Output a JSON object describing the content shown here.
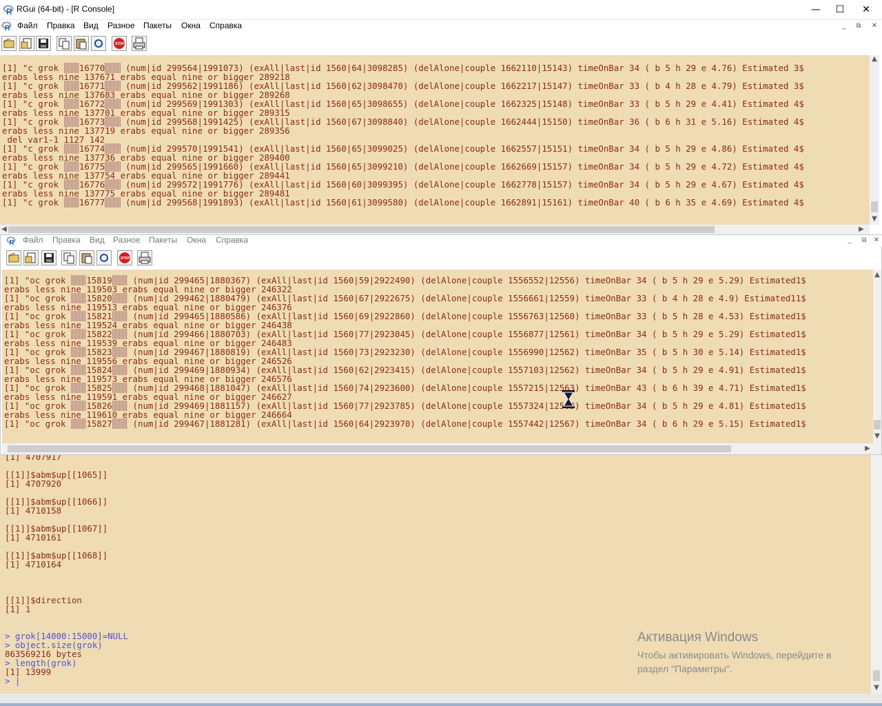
{
  "window": {
    "title": "RGui (64-bit) - [R Console]"
  },
  "menu": [
    "Файл",
    "Правка",
    "Вид",
    "Разное",
    "Пакеты",
    "Окна",
    "Справка"
  ],
  "toolbar_icons": [
    "open-script-icon",
    "load-workspace-icon",
    "save-icon",
    "copy-icon",
    "paste-icon",
    "copy-paste-icon",
    "stop-icon",
    "print-icon"
  ],
  "colors": {
    "console_bg": "#efdcb4",
    "output_text": "#8b2a1a",
    "input_text": "#5050e0"
  },
  "console_top": {
    "lines": [
      [
        "[1] \"c grok ",
        "▒▒▒",
        "16770",
        "▒▒▒",
        " (num|id 299564|1991073) (exAll|last|id 1560|64|3098285) (delAlone|couple 1662110|15143) timeOnBar 34 ( b 5 h 29 e 4.76) Estimated 3$"
      ],
      [
        "erabs less nine 137671 erabs equal nine or bigger 289218"
      ],
      [
        "[1] \"c grok ",
        "▒▒▒",
        "16771",
        "▒▒▒",
        " (num|id 299562|1991186) (exAll|last|id 1560|62|3098470) (delAlone|couple 1662217|15147) timeOnBar 33 ( b 4 h 28 e 4.79) Estimated 3$"
      ],
      [
        "erabs less nine 137683 erabs equal nine or bigger 289268"
      ],
      [
        "[1] \"c grok ",
        "▒▒▒",
        "16772",
        "▒▒▒",
        " (num|id 299569|1991303) (exAll|last|id 1560|65|3098655) (delAlone|couple 1662325|15148) timeOnBar 33 ( b 5 h 29 e 4.41) Estimated 4$"
      ],
      [
        "erabs less nine 137701 erabs equal nine or bigger 289315"
      ],
      [
        "[1] \"c grok ",
        "▒▒▒",
        "16773",
        "▒▒▒",
        " (num|id 299568|1991425) (exAll|last|id 1560|67|3098840) (delAlone|couple 1662444|15150) timeOnBar 36 ( b 6 h 31 e 5.16) Estimated 4$"
      ],
      [
        "erabs less nine 137719 erabs equal nine or bigger 289356"
      ],
      [
        " del var1-1 1127 142"
      ],
      [
        "[1] \"c grok ",
        "▒▒▒",
        "16774",
        "▒▒▒",
        " (num|id 299570|1991541) (exAll|last|id 1560|65|3099025) (delAlone|couple 1662557|15151) timeOnBar 34 ( b 5 h 29 e 4.86) Estimated 4$"
      ],
      [
        "erabs less nine 137736 erabs equal nine or bigger 289400"
      ],
      [
        "[1] \"c grok ",
        "▒▒▒",
        "16775",
        "▒▒▒",
        " (num|id 299565|1991660) (exAll|last|id 1560|65|3099210) (delAlone|couple 1662669|15157) timeOnBar 34 ( b 5 h 29 e 4.72) Estimated 4$"
      ],
      [
        "erabs less nine 137754 erabs equal nine or bigger 289441"
      ],
      [
        "[1] \"c grok ",
        "▒▒▒",
        "16776",
        "▒▒▒",
        " (num|id 299572|1991776) (exAll|last|id 1560|60|3099395) (delAlone|couple 1662778|15157) timeOnBar 34 ( b 5 h 29 e 4.67) Estimated 4$"
      ],
      [
        "erabs less nine 137775 erabs equal nine or bigger 289481"
      ],
      [
        "[1] \"c grok ",
        "▒▒▒",
        "16777",
        "▒▒▒",
        " (num|id 299568|1991893) (exAll|last|id 1560|61|3099580) (delAlone|couple 1662891|15161) timeOnBar 40 ( b 6 h 35 e 4.69) Estimated 4$"
      ]
    ]
  },
  "console_middle": {
    "menu": [
      "Файл",
      "Правка",
      "Вид",
      "Разное",
      "Пакеты",
      "Окна",
      "Справка"
    ],
    "lines": [
      [
        "[1] \"oc grok ",
        "▒▒▒",
        "15819",
        "▒▒▒",
        " (num|id 299465|1880367) (exAll|last|id 1560|59|2922490) (delAlone|couple 1556552|12556) timeOnBar 34 ( b 5 h 29 e 5.29) Estimated1$"
      ],
      [
        "erabs less nine 119503 erabs equal nine or bigger 246322"
      ],
      [
        "[1] \"oc grok ",
        "▒▒▒",
        "15820",
        "▒▒▒",
        " (num|id 299462|1880479) (exAll|last|id 1560|67|2922675) (delAlone|couple 1556661|12559) timeOnBar 33 ( b 4 h 28 e 4.9) Estimated11$"
      ],
      [
        "erabs less nine 119513 erabs equal nine or bigger 246376"
      ],
      [
        "[1] \"oc grok ",
        "▒▒▒",
        "15821",
        "▒▒▒",
        " (num|id 299465|1880586) (exAll|last|id 1560|69|2922860) (delAlone|couple 1556763|12560) timeOnBar 33 ( b 5 h 28 e 4.53) Estimated1$"
      ],
      [
        "erabs less nine 119524 erabs equal nine or bigger 246438"
      ],
      [
        "[1] \"oc grok ",
        "▒▒▒",
        "15822",
        "▒▒▒",
        " (num|id 299466|1880703) (exAll|last|id 1560|77|2923045) (delAlone|couple 1556877|12561) timeOnBar 34 ( b 5 h 29 e 5.29) Estimated1$"
      ],
      [
        "erabs less nine 119539 erabs equal nine or bigger 246483"
      ],
      [
        "[1] \"oc grok ",
        "▒▒▒",
        "15823",
        "▒▒▒",
        " (num|id 299467|1880819) (exAll|last|id 1560|73|2923230) (delAlone|couple 1556990|12562) timeOnBar 35 ( b 5 h 30 e 5.14) Estimated1$"
      ],
      [
        "erabs less nine 119556 erabs equal nine or bigger 246526"
      ],
      [
        "[1] \"oc grok ",
        "▒▒▒",
        "15824",
        "▒▒▒",
        " (num|id 299469|1880934) (exAll|last|id 1560|62|2923415) (delAlone|couple 1557103|12562) timeOnBar 34 ( b 5 h 29 e 4.91) Estimated1$"
      ],
      [
        "erabs less nine 119573 erabs equal nine or bigger 246576"
      ],
      [
        "[1] \"oc grok ",
        "▒▒▒",
        "15825",
        "▒▒▒",
        " (num|id 299468|1881047) (exAll|last|id 1560|74|2923600) (delAlone|couple 1557215|12563) timeOnBar 43 ( b 6 h 39 e 4.71) Estimated1$"
      ],
      [
        "erabs less nine 119591 erabs equal nine or bigger 246627"
      ],
      [
        "[1] \"oc grok ",
        "▒▒▒",
        "15826",
        "▒▒▒",
        " (num|id 299469|1881157) (exAll|last|id 1560|77|2923785) (delAlone|couple 1557324|12563) timeOnBar 34 ( b 5 h 29 e 4.81) Estimated1$"
      ],
      [
        "erabs less nine 119610 erabs equal nine or bigger 246664"
      ],
      [
        "[1] \"oc grok ",
        "▒▒▒",
        "15827",
        "▒▒▒",
        " (num|id 299467|1881281) (exAll|last|id 1560|64|2923970) (delAlone|couple 1557442|12567) timeOnBar 34 ( b 6 h 29 e 5.15) Estimated1$"
      ]
    ]
  },
  "console_bottom": {
    "lines": [
      {
        "text": "[1] 4707917",
        "kind": "out"
      },
      {
        "text": "",
        "kind": "out"
      },
      {
        "text": "[[1]]$abm$up[[1065]]",
        "kind": "out"
      },
      {
        "text": "[1] 4707920",
        "kind": "out"
      },
      {
        "text": "",
        "kind": "out"
      },
      {
        "text": "[[1]]$abm$up[[1066]]",
        "kind": "out"
      },
      {
        "text": "[1] 4710158",
        "kind": "out"
      },
      {
        "text": "",
        "kind": "out"
      },
      {
        "text": "[[1]]$abm$up[[1067]]",
        "kind": "out"
      },
      {
        "text": "[1] 4710161",
        "kind": "out"
      },
      {
        "text": "",
        "kind": "out"
      },
      {
        "text": "[[1]]$abm$up[[1068]]",
        "kind": "out"
      },
      {
        "text": "[1] 4710164",
        "kind": "out"
      },
      {
        "text": "",
        "kind": "out"
      },
      {
        "text": "",
        "kind": "out"
      },
      {
        "text": "",
        "kind": "out"
      },
      {
        "text": "[[1]]$direction",
        "kind": "out"
      },
      {
        "text": "[1] 1",
        "kind": "out"
      },
      {
        "text": "",
        "kind": "out"
      },
      {
        "text": "",
        "kind": "out"
      },
      {
        "text": "> grok[14000:15000]=NULL",
        "kind": "in"
      },
      {
        "text": "> object.size(grok)",
        "kind": "in"
      },
      {
        "text": "863569216 bytes",
        "kind": "out"
      },
      {
        "text": "> length(grok)",
        "kind": "in"
      },
      {
        "text": "[1] 13999",
        "kind": "out"
      },
      {
        "text": "> |",
        "kind": "in"
      }
    ]
  },
  "watermark": {
    "title": "Активация Windows",
    "line1": "Чтобы активировать Windows, перейдите в",
    "line2": "раздел \"Параметры\"."
  }
}
